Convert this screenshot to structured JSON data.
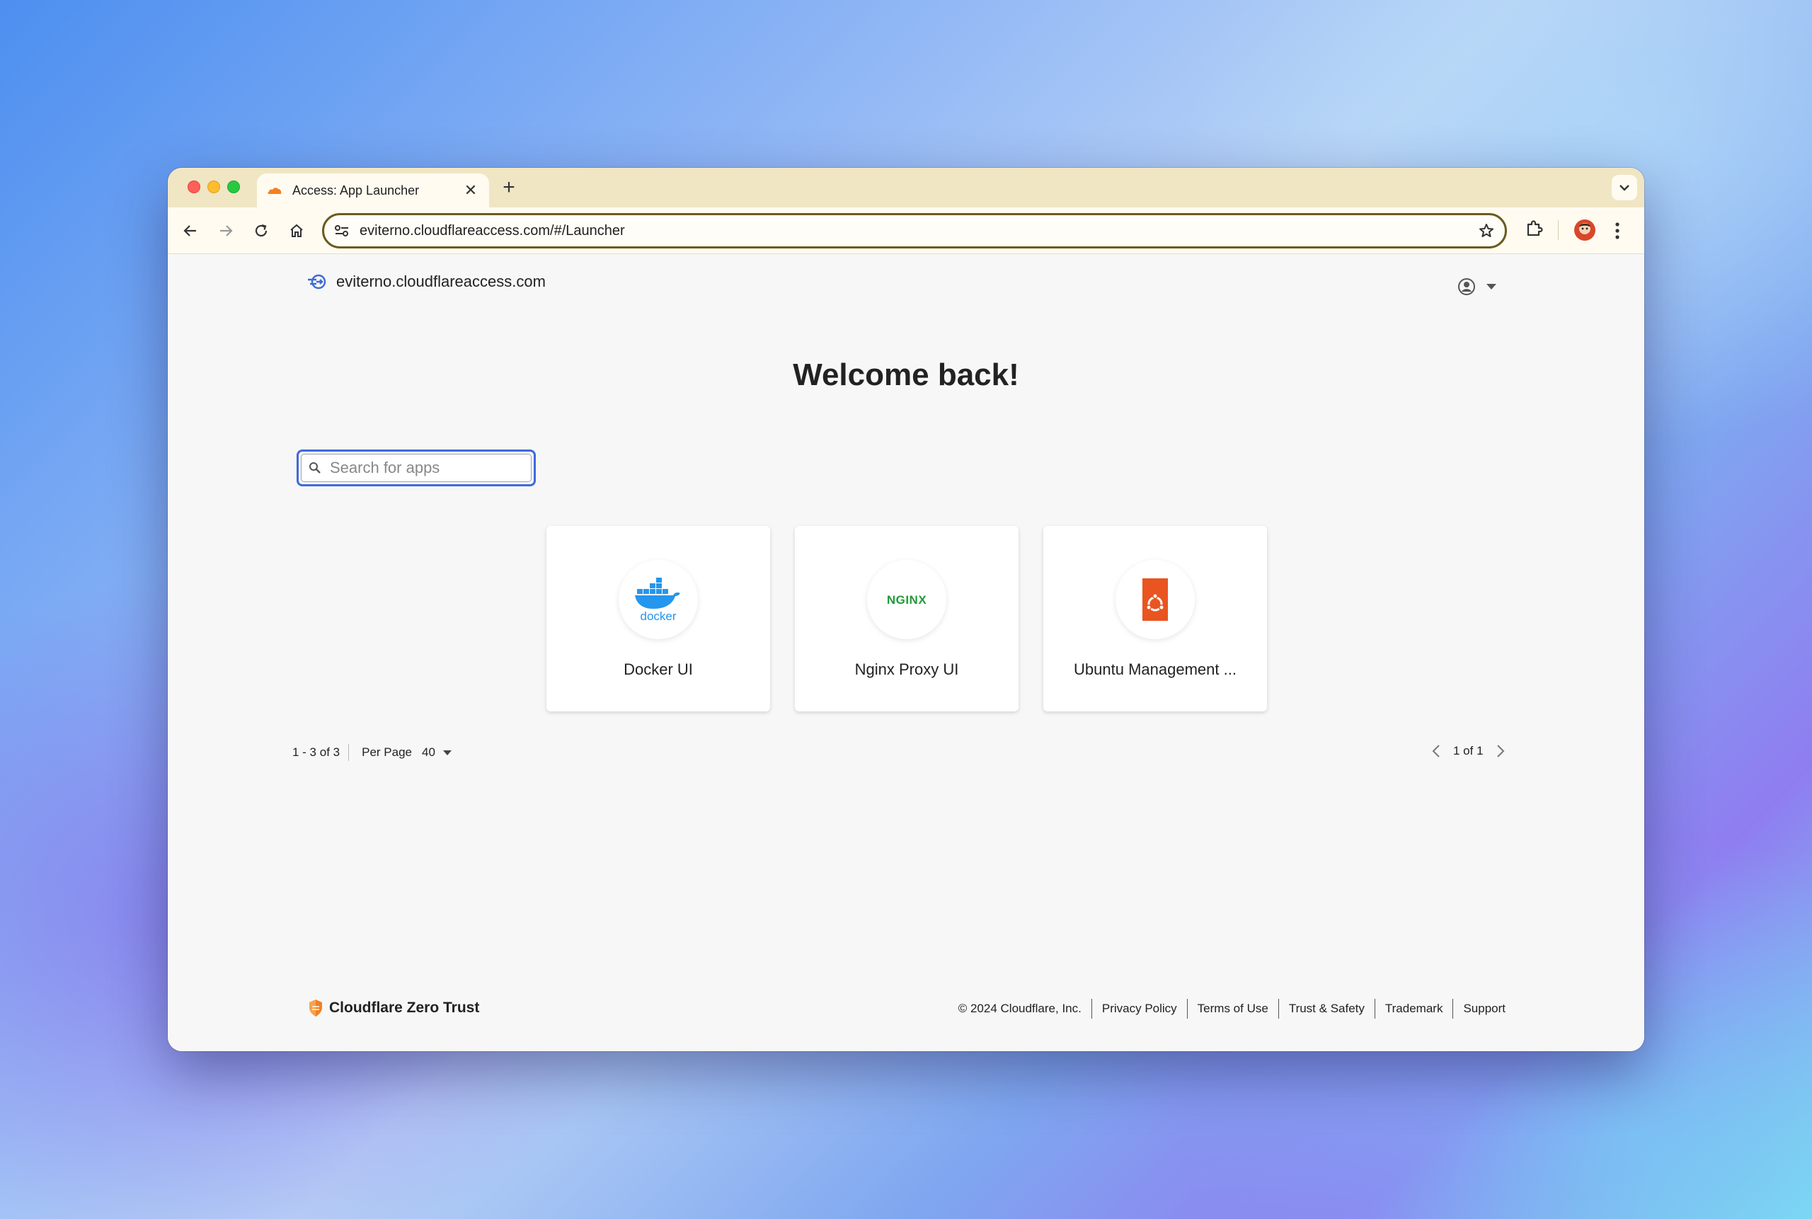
{
  "browser": {
    "tab_title": "Access: App Launcher",
    "url": "eviterno.cloudflareaccess.com/#/Launcher"
  },
  "header": {
    "site_name": "eviterno.cloudflareaccess.com"
  },
  "main": {
    "welcome": "Welcome back!",
    "search_placeholder": "Search for apps",
    "apps": [
      {
        "label": "Docker UI",
        "logo_text": "docker"
      },
      {
        "label": "Nginx Proxy UI",
        "logo_text": "NGINX"
      },
      {
        "label": "Ubuntu Management ...",
        "logo_text": ""
      }
    ]
  },
  "pagination": {
    "range": "1 - 3 of 3",
    "per_page_label": "Per Page",
    "per_page_value": "40",
    "page_status": "1 of 1"
  },
  "footer": {
    "brand": "Cloudflare Zero Trust",
    "copyright": "© 2024 Cloudflare, Inc.",
    "links": [
      "Privacy Policy",
      "Terms of Use",
      "Trust & Safety",
      "Trademark",
      "Support"
    ]
  },
  "colors": {
    "accent_focus": "#3f6ad8",
    "tabstrip": "#f0e6c4",
    "cloudflare_orange": "#f38020"
  }
}
